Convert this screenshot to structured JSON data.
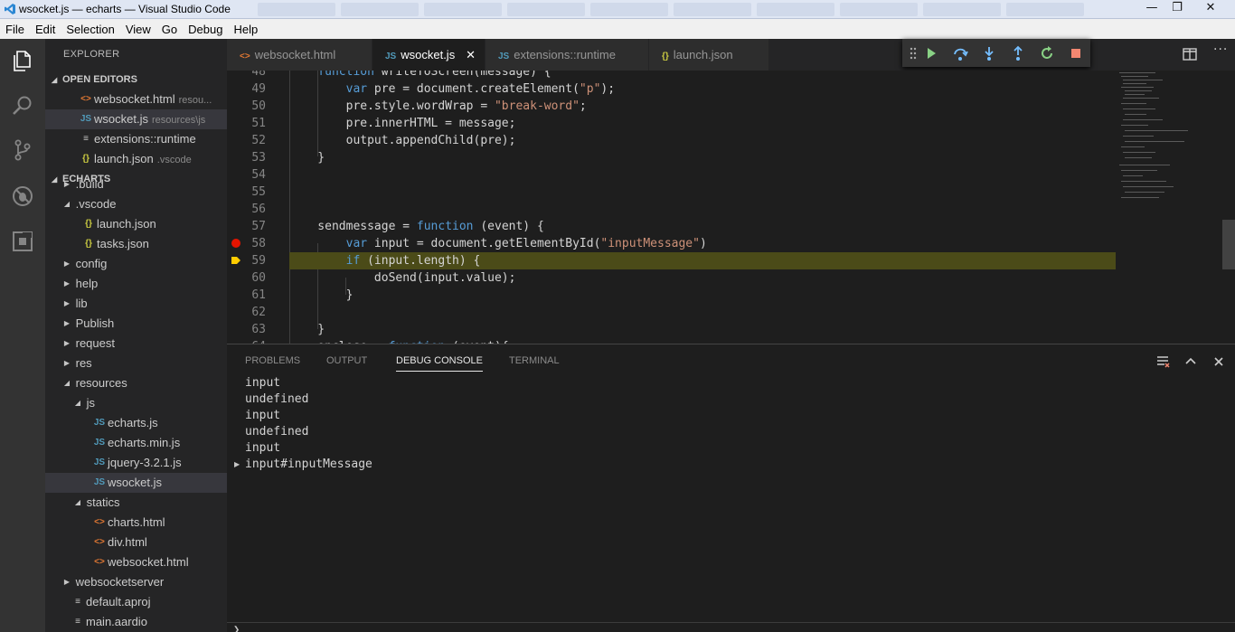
{
  "window": {
    "title": "wsocket.js — echarts — Visual Studio Code",
    "minimize": "—",
    "maximize": "❐",
    "close": "✕"
  },
  "menu": [
    "File",
    "Edit",
    "Selection",
    "View",
    "Go",
    "Debug",
    "Help"
  ],
  "sidebar": {
    "title": "EXPLORER",
    "open_editors_label": "OPEN EDITORS",
    "open_editors": [
      {
        "name": "websocket.html",
        "desc": "resou...",
        "type": "html"
      },
      {
        "name": "wsocket.js",
        "desc": "resources\\js",
        "type": "js",
        "selected": true
      },
      {
        "name": "extensions::runtime",
        "desc": "",
        "type": "plain"
      },
      {
        "name": "launch.json",
        "desc": ".vscode",
        "type": "json"
      }
    ],
    "folder_label": "ECHARTS",
    "tree": [
      {
        "name": ".build",
        "kind": "folder-closed",
        "depth": 0
      },
      {
        "name": ".vscode",
        "kind": "folder-open",
        "depth": 0
      },
      {
        "name": "launch.json",
        "kind": "json",
        "depth": 1
      },
      {
        "name": "tasks.json",
        "kind": "json",
        "depth": 1
      },
      {
        "name": "config",
        "kind": "folder-closed",
        "depth": 0
      },
      {
        "name": "help",
        "kind": "folder-closed",
        "depth": 0
      },
      {
        "name": "lib",
        "kind": "folder-closed",
        "depth": 0
      },
      {
        "name": "Publish",
        "kind": "folder-closed",
        "depth": 0
      },
      {
        "name": "request",
        "kind": "folder-closed",
        "depth": 0
      },
      {
        "name": "res",
        "kind": "folder-closed",
        "depth": 0
      },
      {
        "name": "resources",
        "kind": "folder-open",
        "depth": 0
      },
      {
        "name": "js",
        "kind": "folder-open",
        "depth": 1
      },
      {
        "name": "echarts.js",
        "kind": "js",
        "depth": 2
      },
      {
        "name": "echarts.min.js",
        "kind": "js",
        "depth": 2
      },
      {
        "name": "jquery-3.2.1.js",
        "kind": "js",
        "depth": 2
      },
      {
        "name": "wsocket.js",
        "kind": "js",
        "depth": 2,
        "selected": true
      },
      {
        "name": "statics",
        "kind": "folder-open",
        "depth": 1
      },
      {
        "name": "charts.html",
        "kind": "html",
        "depth": 2
      },
      {
        "name": "div.html",
        "kind": "html",
        "depth": 2
      },
      {
        "name": "websocket.html",
        "kind": "html",
        "depth": 2
      },
      {
        "name": "websocketserver",
        "kind": "folder-closed",
        "depth": 0
      },
      {
        "name": "default.aproj",
        "kind": "plain",
        "depth": 0
      },
      {
        "name": "main.aardio",
        "kind": "plain",
        "depth": 0
      }
    ]
  },
  "tabs": [
    {
      "label": "websocket.html",
      "type": "html",
      "icon": "<>"
    },
    {
      "label": "wsocket.js",
      "type": "js",
      "icon": "JS",
      "active": true
    },
    {
      "label": "extensions::runtime",
      "type": "js",
      "icon": "JS"
    },
    {
      "label": "launch.json",
      "type": "json",
      "icon": "{}"
    }
  ],
  "debug_toolbar": [
    "drag-handle",
    "continue",
    "step-over",
    "step-into",
    "step-out",
    "restart",
    "stop"
  ],
  "editor": {
    "lines": [
      {
        "n": "48",
        "tokens": [
          [
            "    ",
            ""
          ],
          [
            "function",
            "kw"
          ],
          [
            " writeToScreen(message) {",
            ""
          ]
        ]
      },
      {
        "n": "49",
        "tokens": [
          [
            "        ",
            ""
          ],
          [
            "var",
            "kw"
          ],
          [
            " pre = document.createElement(",
            ""
          ],
          [
            "\"p\"",
            "str"
          ],
          [
            ");",
            ""
          ]
        ]
      },
      {
        "n": "50",
        "tokens": [
          [
            "        pre.style.wordWrap = ",
            ""
          ],
          [
            "\"break-word\"",
            "str"
          ],
          [
            ";",
            ""
          ]
        ]
      },
      {
        "n": "51",
        "tokens": [
          [
            "        pre.innerHTML = message;",
            ""
          ]
        ]
      },
      {
        "n": "52",
        "tokens": [
          [
            "        output.appendChild(pre);",
            ""
          ]
        ]
      },
      {
        "n": "53",
        "tokens": [
          [
            "    }",
            ""
          ]
        ]
      },
      {
        "n": "54",
        "tokens": []
      },
      {
        "n": "55",
        "tokens": []
      },
      {
        "n": "56",
        "tokens": []
      },
      {
        "n": "57",
        "tokens": [
          [
            "    sendmessage = ",
            ""
          ],
          [
            "function",
            "kw"
          ],
          [
            " (event) {",
            ""
          ]
        ]
      },
      {
        "n": "58",
        "tokens": [
          [
            "        ",
            ""
          ],
          [
            "var",
            "kw"
          ],
          [
            " input = document.getElementById(",
            ""
          ],
          [
            "\"inputMessage\"",
            "str"
          ],
          [
            ")",
            ""
          ]
        ],
        "breakpoint": true
      },
      {
        "n": "59",
        "tokens": [
          [
            "        ",
            ""
          ],
          [
            "if",
            "kw"
          ],
          [
            " (input.length) {",
            ""
          ]
        ],
        "current": true
      },
      {
        "n": "60",
        "tokens": [
          [
            "            doSend(input.value);",
            ""
          ]
        ]
      },
      {
        "n": "61",
        "tokens": [
          [
            "        }",
            ""
          ]
        ]
      },
      {
        "n": "62",
        "tokens": []
      },
      {
        "n": "63",
        "tokens": [
          [
            "    }",
            ""
          ]
        ]
      },
      {
        "n": "64",
        "tokens": [
          [
            "    onclose = ",
            ""
          ],
          [
            "function",
            "kw"
          ],
          [
            " (event){",
            ""
          ]
        ]
      }
    ]
  },
  "panel": {
    "tabs": [
      {
        "label": "PROBLEMS"
      },
      {
        "label": "OUTPUT"
      },
      {
        "label": "DEBUG CONSOLE",
        "active": true
      },
      {
        "label": "TERMINAL"
      }
    ],
    "console": [
      {
        "text": "input"
      },
      {
        "text": "undefined"
      },
      {
        "text": "input"
      },
      {
        "text": "undefined"
      },
      {
        "text": "input"
      },
      {
        "text": "input#inputMessage",
        "expandable": true
      }
    ],
    "prompt": "❯"
  },
  "colors": {
    "activity_bar": "#333333",
    "sidebar": "#252526",
    "editor": "#1e1e1e",
    "current_line": "#4b4b18",
    "breakpoint": "#e51400",
    "debug_arrow": "#ffcc00"
  }
}
